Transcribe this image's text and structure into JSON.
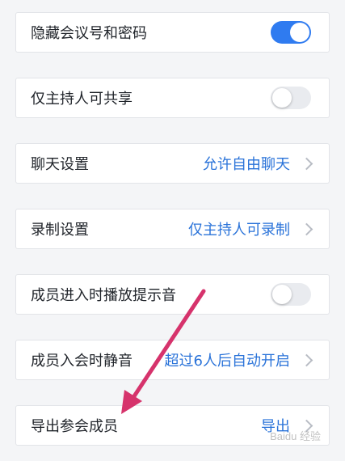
{
  "settings": [
    {
      "label": "隐藏会议号和密码",
      "kind": "toggle",
      "on": true
    },
    {
      "label": "仅主持人可共享",
      "kind": "toggle",
      "on": false
    },
    {
      "label": "聊天设置",
      "kind": "link",
      "value": "允许自由聊天"
    },
    {
      "label": "录制设置",
      "kind": "link",
      "value": "仅主持人可录制"
    },
    {
      "label": "成员进入时播放提示音",
      "kind": "toggle",
      "on": false
    },
    {
      "label": "成员入会时静音",
      "kind": "link",
      "value": "超过6人后自动开启"
    },
    {
      "label": "导出参会成员",
      "kind": "link",
      "value": "导出"
    }
  ],
  "annotation": {
    "color": "#d6336c",
    "points_to": "导出参会成员"
  },
  "colors": {
    "accent": "#2f7bf0",
    "value_text": "#2a73d9"
  },
  "watermark": {
    "text": "Baidu 经验"
  }
}
